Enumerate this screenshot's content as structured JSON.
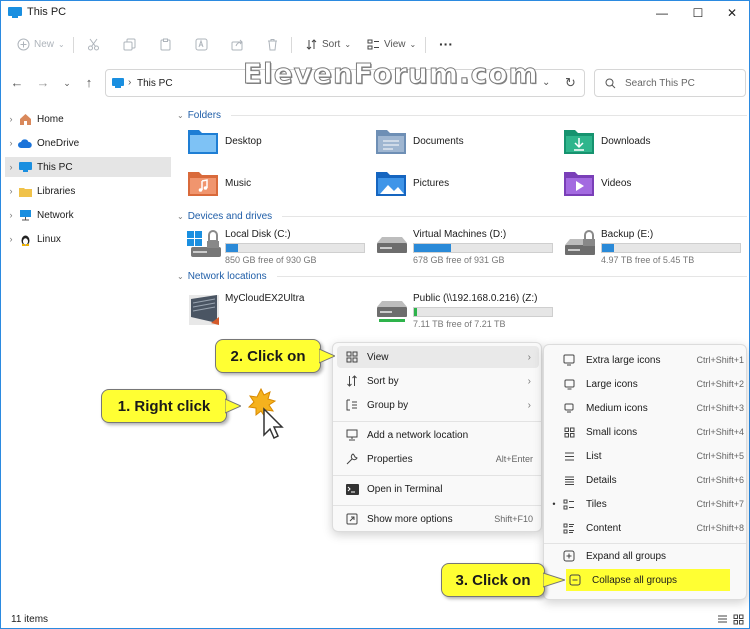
{
  "window": {
    "title": "This PC",
    "controls": {
      "minimize": "—",
      "maximize": "☐",
      "close": "✕"
    }
  },
  "toolbar": {
    "new_label": "New",
    "sort_label": "Sort",
    "view_label": "View",
    "more_label": "···"
  },
  "address": {
    "crumb": "This PC",
    "search_placeholder": "Search This PC"
  },
  "watermark": "ElevenForum.com",
  "sidebar": {
    "items": [
      {
        "label": "Home",
        "icon": "home-icon"
      },
      {
        "label": "OneDrive",
        "icon": "cloud-icon"
      },
      {
        "label": "This PC",
        "icon": "pc-icon",
        "selected": true
      },
      {
        "label": "Libraries",
        "icon": "library-icon"
      },
      {
        "label": "Network",
        "icon": "network-icon"
      },
      {
        "label": "Linux",
        "icon": "linux-icon"
      }
    ]
  },
  "groups": {
    "folders": "Folders",
    "devices": "Devices and drives",
    "network": "Network locations"
  },
  "folders": [
    {
      "label": "Desktop"
    },
    {
      "label": "Documents"
    },
    {
      "label": "Downloads"
    },
    {
      "label": "Music"
    },
    {
      "label": "Pictures"
    },
    {
      "label": "Videos"
    }
  ],
  "drives": [
    {
      "name": "Local Disk (C:)",
      "free": "850 GB free of 930 GB",
      "used_fraction": 0.09
    },
    {
      "name": "Virtual Machines (D:)",
      "free": "678 GB free of 931 GB",
      "used_fraction": 0.27
    },
    {
      "name": "Backup (E:)",
      "free": "4.97 TB free of 5.45 TB",
      "used_fraction": 0.09
    }
  ],
  "network_locations": [
    {
      "name": "MyCloudEX2Ultra"
    },
    {
      "name": "Public (\\\\192.168.0.216) (Z:)",
      "free": "7.11 TB free of 7.21 TB",
      "used_fraction": 0.02
    }
  ],
  "context_menu": {
    "items": [
      {
        "label": "View",
        "arrow": "›"
      },
      {
        "label": "Sort by",
        "arrow": "›"
      },
      {
        "label": "Group by",
        "arrow": "›"
      },
      {
        "label": "Add a network location",
        "shortcut": ""
      },
      {
        "label": "Properties",
        "shortcut": "Alt+Enter"
      },
      {
        "label": "Open in Terminal",
        "shortcut": ""
      },
      {
        "label": "Show more options",
        "shortcut": "Shift+F10"
      }
    ]
  },
  "view_submenu": {
    "items": [
      {
        "label": "Extra large icons",
        "shortcut": "Ctrl+Shift+1"
      },
      {
        "label": "Large icons",
        "shortcut": "Ctrl+Shift+2"
      },
      {
        "label": "Medium icons",
        "shortcut": "Ctrl+Shift+3"
      },
      {
        "label": "Small icons",
        "shortcut": "Ctrl+Shift+4"
      },
      {
        "label": "List",
        "shortcut": "Ctrl+Shift+5"
      },
      {
        "label": "Details",
        "shortcut": "Ctrl+Shift+6"
      },
      {
        "label": "Tiles",
        "shortcut": "Ctrl+Shift+7",
        "selected_mark": "•"
      },
      {
        "label": "Content",
        "shortcut": "Ctrl+Shift+8"
      },
      {
        "label": "Expand all groups"
      },
      {
        "label": "Collapse all groups"
      }
    ]
  },
  "callouts": {
    "step1": "1. Right click",
    "step2": "2. Click on",
    "step3": "3. Click on"
  },
  "status": {
    "count": "11 items"
  }
}
